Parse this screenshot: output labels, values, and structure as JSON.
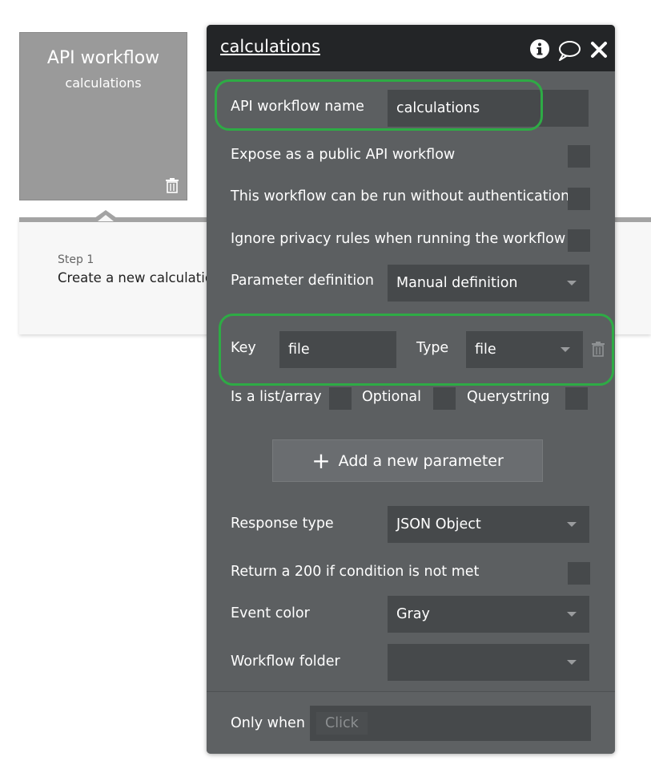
{
  "canvas": {
    "workflow_card": {
      "title": "API workflow",
      "subtitle": "calculations"
    },
    "step": {
      "label": "Step 1",
      "action": "Create a new calculatio"
    }
  },
  "panel": {
    "title": "calculations",
    "header_icons": [
      "info-icon",
      "comment-icon",
      "close-icon"
    ],
    "api_workflow_name": {
      "label": "API workflow name",
      "value": "calculations"
    },
    "expose_public": {
      "label": "Expose as a public API workflow",
      "checked": false
    },
    "run_without_auth": {
      "label": "This workflow can be run without authentication",
      "checked": false
    },
    "ignore_privacy": {
      "label": "Ignore privacy rules when running the workflow",
      "checked": false
    },
    "parameter_definition": {
      "label": "Parameter definition",
      "value": "Manual definition"
    },
    "parameter": {
      "key_label": "Key",
      "key_value": "file",
      "type_label": "Type",
      "type_value": "file",
      "is_list_label": "Is a list/array",
      "optional_label": "Optional",
      "querystring_label": "Querystring"
    },
    "add_parameter_label": "Add a new parameter",
    "response_type": {
      "label": "Response type",
      "value": "JSON Object"
    },
    "return_200": {
      "label": "Return a 200 if condition is not met",
      "checked": false
    },
    "event_color": {
      "label": "Event color",
      "value": "Gray"
    },
    "workflow_folder": {
      "label": "Workflow folder",
      "value": ""
    },
    "only_when": {
      "label": "Only when",
      "placeholder": "Click"
    }
  },
  "colors": {
    "panel_bg": "#5c5f61",
    "header_bg": "#232527",
    "field_bg": "#46494b",
    "highlight": "#2eab45",
    "card_bg": "#9a9a9a"
  }
}
